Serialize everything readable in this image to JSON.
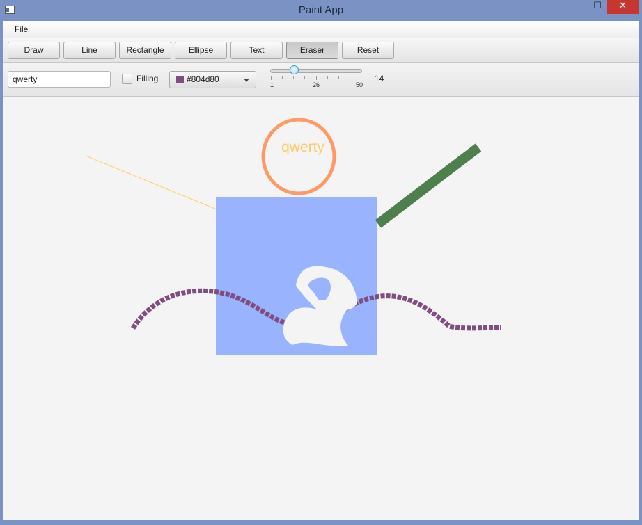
{
  "window": {
    "title": "Paint App",
    "minimize_glyph": "‒",
    "maximize_glyph": "☐",
    "close_glyph": "✕"
  },
  "menubar": {
    "file": "File"
  },
  "toolbar": {
    "draw": "Draw",
    "line": "Line",
    "rectangle": "Rectangle",
    "ellipse": "Ellipse",
    "text": "Text",
    "eraser": "Eraser",
    "reset": "Reset",
    "active_tool": "Eraser"
  },
  "options": {
    "text_value": "qwerty",
    "filling_label": "Filling",
    "filling_checked": false,
    "color_value": "#804d80",
    "slider": {
      "min_label": "1",
      "mid_label": "26",
      "max_label": "50",
      "min": 1,
      "max": 50,
      "value": 14
    },
    "size_value": "14"
  },
  "canvas": {
    "text_drawn": "qwerty",
    "colors": {
      "rectangle": "#99b3ff",
      "ellipse": "#ff9966",
      "text": "#ffcc66",
      "thick_line": "#4d804d",
      "thin_line": "#ffcc66",
      "stroke": "#804d80"
    }
  }
}
